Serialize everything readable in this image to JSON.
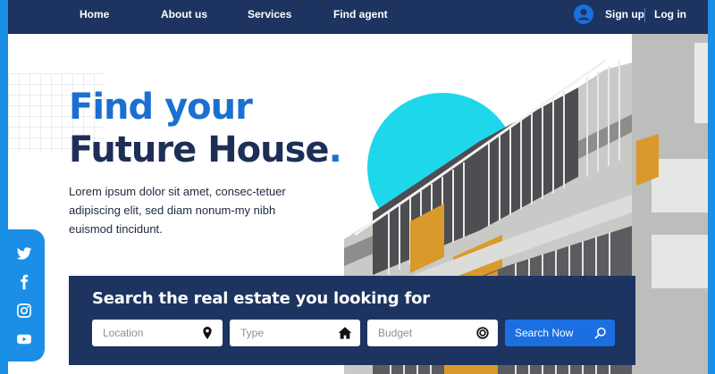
{
  "nav": {
    "links": [
      "Home",
      "About us",
      "Services",
      "Find agent"
    ],
    "signup": "Sign up",
    "login": "Log in"
  },
  "hero": {
    "title_line1": "Find your",
    "title_line2": "Future House",
    "title_dot": ".",
    "description": "Lorem ipsum dolor sit amet, consec-tetuer adipiscing elit, sed diam nonum-my nibh euismod tincidunt."
  },
  "social": {
    "icons": [
      "twitter-icon",
      "facebook-icon",
      "instagram-icon",
      "youtube-icon"
    ]
  },
  "search": {
    "title": "Search the real estate you looking for",
    "location_placeholder": "Location",
    "type_placeholder": "Type",
    "budget_placeholder": "Budget",
    "button_label": "Search Now"
  },
  "colors": {
    "navy": "#1d3461",
    "accent_blue": "#1b6fe0",
    "sidebar_blue": "#1b8fe6",
    "cyan_circle": "#1ed7ea"
  }
}
